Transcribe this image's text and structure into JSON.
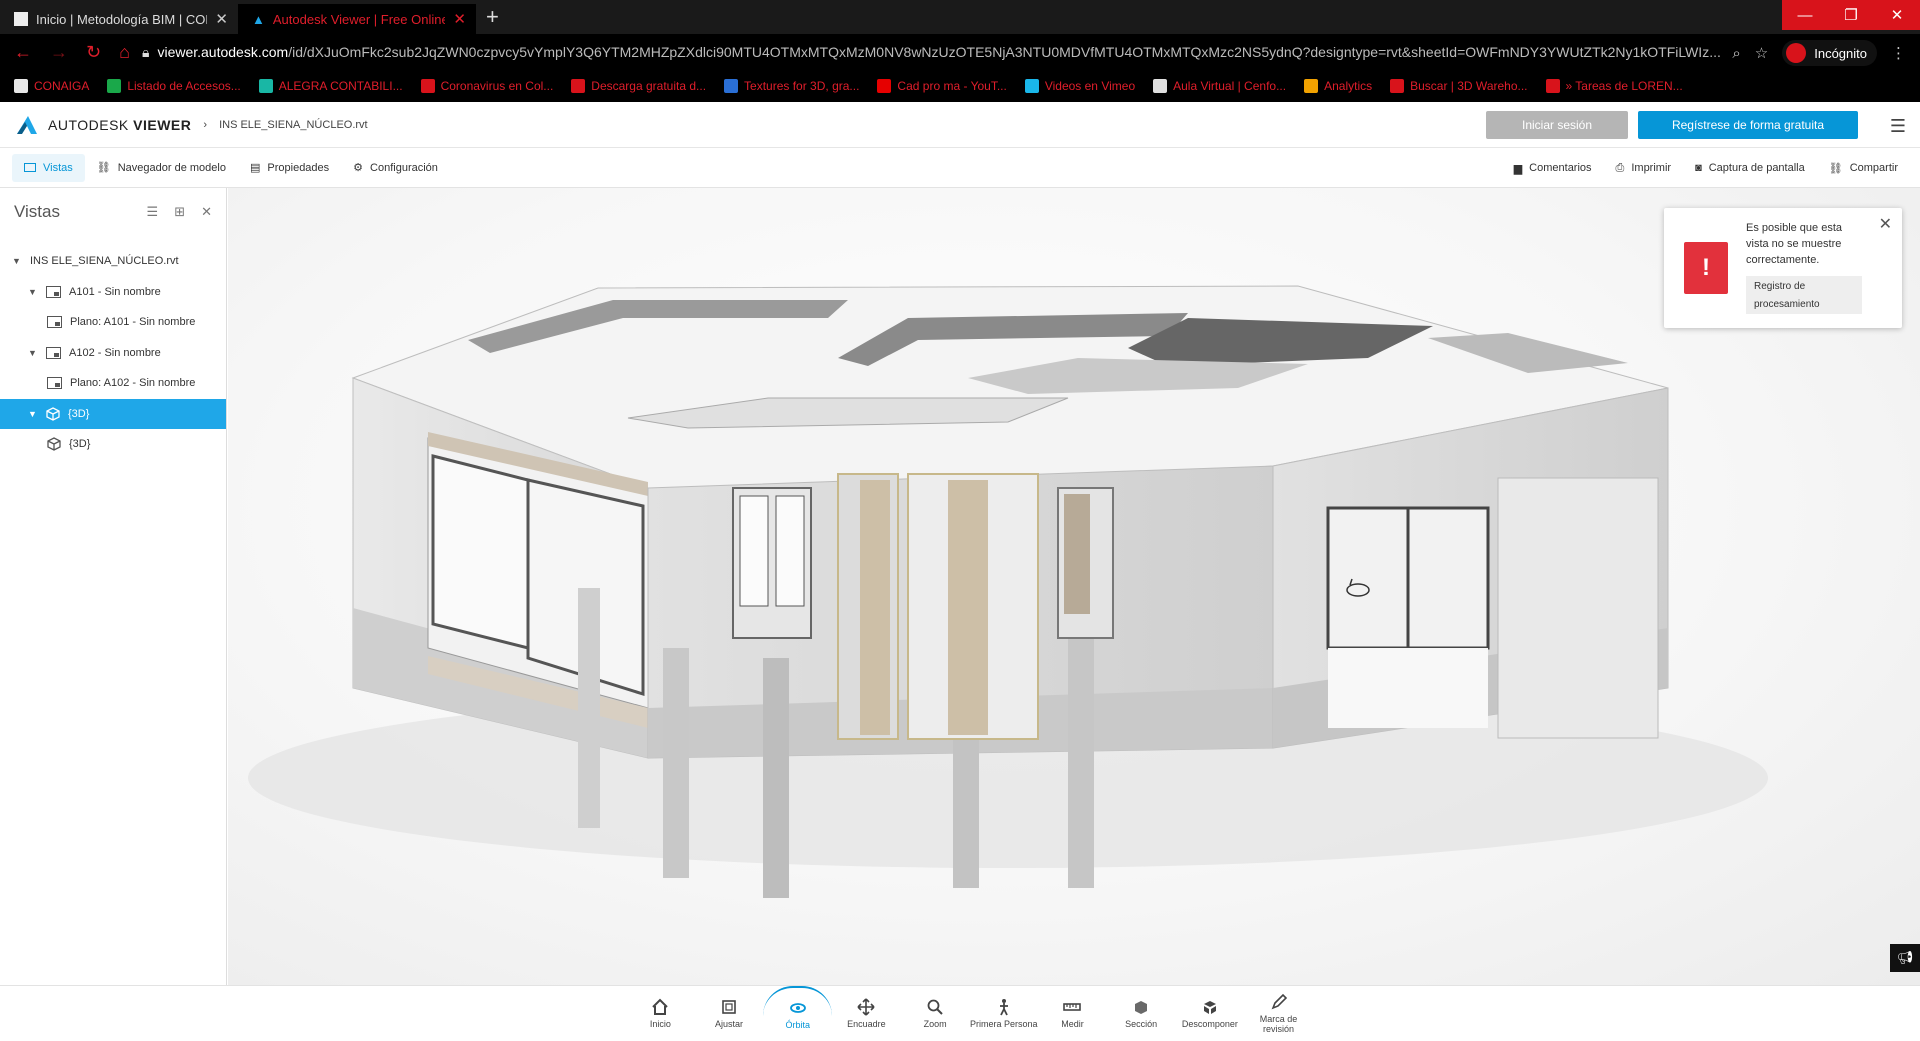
{
  "browser": {
    "tabs": [
      {
        "title": "Inicio | Metodología BIM | CONC",
        "close": "✕"
      },
      {
        "title": "Autodesk Viewer | Free Online F",
        "close": "✕"
      }
    ],
    "new_tab": "+",
    "window_controls": {
      "minimize": "—",
      "restore": "❐",
      "close": "✕"
    },
    "url_host": "viewer.autodesk.com",
    "url_path": "/id/dXJuOmFkc2sub2JqZWN0czpvcy5vYmplY3Q6YTM2MHZpZXdlci90MTU4OTMxMTQxMzM0NV8wNzUzOTE5NjA3NTU0MDVfMTU4OTMxMTQxMzc2NS5ydnQ?designtype=rvt&sheetId=OWFmNDY3YWUtZTk2Ny1kOTFiLWIz...",
    "profile_label": "Incógnito",
    "bookmarks": [
      {
        "label": "CONAIGA",
        "color": "#e8e8e8"
      },
      {
        "label": "Listado de Accesos...",
        "color": "#1aa84a"
      },
      {
        "label": "ALEGRA CONTABILI...",
        "color": "#19b7a5"
      },
      {
        "label": "Coronavirus en Col...",
        "color": "#d8131b"
      },
      {
        "label": "Descarga gratuita d...",
        "color": "#d8131b"
      },
      {
        "label": "Textures for 3D, gra...",
        "color": "#2a6fd6"
      },
      {
        "label": "Cad pro ma - YouT...",
        "color": "#e60000"
      },
      {
        "label": "Videos en Vimeo",
        "color": "#1ab7ea"
      },
      {
        "label": "Aula Virtual | Cenfo...",
        "color": "#e0e0e0"
      },
      {
        "label": "Analytics",
        "color": "#f2a200"
      },
      {
        "label": "Buscar | 3D Wareho...",
        "color": "#d8131b"
      },
      {
        "label": "» Tareas de LOREN...",
        "color": "#d8131b"
      }
    ]
  },
  "app": {
    "brand_prefix": "AUTODESK",
    "brand_suffix": "VIEWER",
    "file_name": "INS ELE_SIENA_NÚCLEO.rvt",
    "sign_in": "Iniciar sesión",
    "register": "Regístrese de forma gratuita",
    "accent": "#0696d7"
  },
  "toolbar": {
    "views": "Vistas",
    "model_browser": "Navegador de modelo",
    "properties": "Propiedades",
    "settings": "Configuración",
    "comments": "Comentarios",
    "print": "Imprimir",
    "screenshot": "Captura de pantalla",
    "share": "Compartir"
  },
  "sidebar": {
    "title": "Vistas",
    "root": "INS ELE_SIENA_NÚCLEO.rvt",
    "items": [
      {
        "label": "A101 - Sin nombre",
        "type": "group"
      },
      {
        "label": "Plano: A101 - Sin nombre",
        "type": "sheet"
      },
      {
        "label": "A102 - Sin nombre",
        "type": "group"
      },
      {
        "label": "Plano: A102 - Sin nombre",
        "type": "sheet"
      },
      {
        "label": "{3D}",
        "type": "3d-group",
        "selected": true
      },
      {
        "label": "{3D}",
        "type": "3d"
      }
    ]
  },
  "notice": {
    "message": "Es posible que esta vista no se muestre correctamente.",
    "button": "Registro de procesamiento"
  },
  "bottom_tools": [
    {
      "label": "Inicio",
      "icon": "home-icon"
    },
    {
      "label": "Ajustar",
      "icon": "fit-icon"
    },
    {
      "label": "Órbita",
      "icon": "orbit-icon",
      "active": true
    },
    {
      "label": "Encuadre",
      "icon": "pan-icon"
    },
    {
      "label": "Zoom",
      "icon": "zoom-icon"
    },
    {
      "label": "Primera Persona",
      "icon": "first-person-icon"
    },
    {
      "label": "Medir",
      "icon": "measure-icon"
    },
    {
      "label": "Sección",
      "icon": "section-icon"
    },
    {
      "label": "Descomponer",
      "icon": "explode-icon"
    },
    {
      "label": "Marca de revisión",
      "icon": "markup-icon"
    }
  ]
}
